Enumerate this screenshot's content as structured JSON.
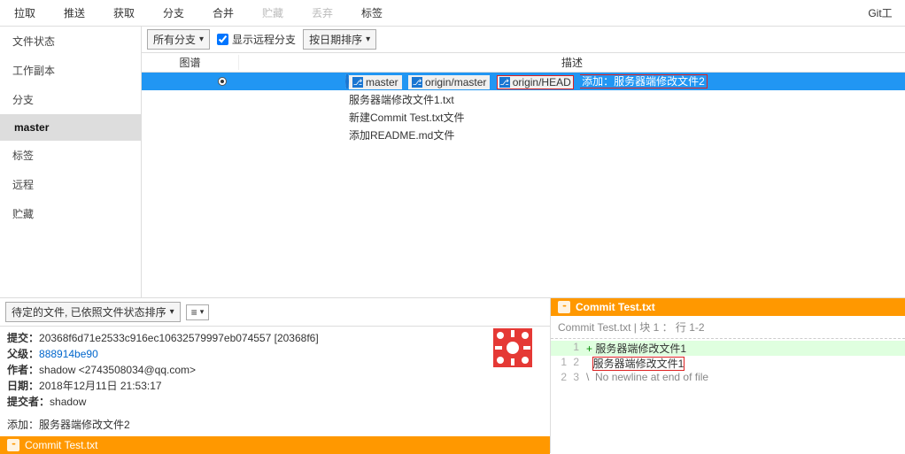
{
  "toolbar": {
    "pull": "拉取",
    "push": "推送",
    "fetch": "获取",
    "branch": "分支",
    "merge": "合并",
    "stash": "贮藏",
    "discard": "丢弃",
    "tag": "标签",
    "git_cli": "Git工"
  },
  "sidebar": {
    "file_status": "文件状态",
    "working_copy": "工作副本",
    "branches": "分支",
    "master": "master",
    "tags": "标签",
    "remotes": "远程",
    "stashes": "贮藏"
  },
  "filter": {
    "all_branches": "所有分支",
    "show_remote": "显示远程分支",
    "date_order": "按日期排序"
  },
  "headers": {
    "graph": "图谱",
    "description": "描述"
  },
  "refs": {
    "master": "master",
    "origin_master": "origin/master",
    "origin_head": "origin/HEAD"
  },
  "commits": [
    {
      "msg": "添加：服务器端修改文件2",
      "selected": true
    },
    {
      "msg": "服务器端修改文件1.txt"
    },
    {
      "msg": "新建Commit Test.txt文件"
    },
    {
      "msg": "添加README.md文件"
    }
  ],
  "sort_select": "待定的文件, 已依照文件状态排序",
  "info": {
    "commit_lbl": "提交：",
    "commit_val": "20368f6d71e2533c916ec10632579997eb074557 [20368f6]",
    "parent_lbl": "父级：",
    "parent_val": "888914be90",
    "author_lbl": "作者：",
    "author_val": "shadow <2743508034@qq.com>",
    "date_lbl": "日期：",
    "date_val": "2018年12月11日 21:53:17",
    "committer_lbl": "提交者：",
    "committer_val": "shadow",
    "summary": "添加：服务器端修改文件2"
  },
  "file": {
    "name": "Commit Test.txt"
  },
  "diff": {
    "header": "Commit Test.txt  | 块 1 ： 行 1-2",
    "lines": [
      {
        "ol": "",
        "nl": "1",
        "type": "add",
        "txt": "服务器端修改文件1"
      },
      {
        "ol": "1",
        "nl": "2",
        "type": "ctx",
        "txt": "服务器端修改文件1",
        "box": true
      },
      {
        "ol": "2",
        "nl": "3",
        "type": "nonl",
        "txt": "No newline at end of file"
      }
    ]
  }
}
